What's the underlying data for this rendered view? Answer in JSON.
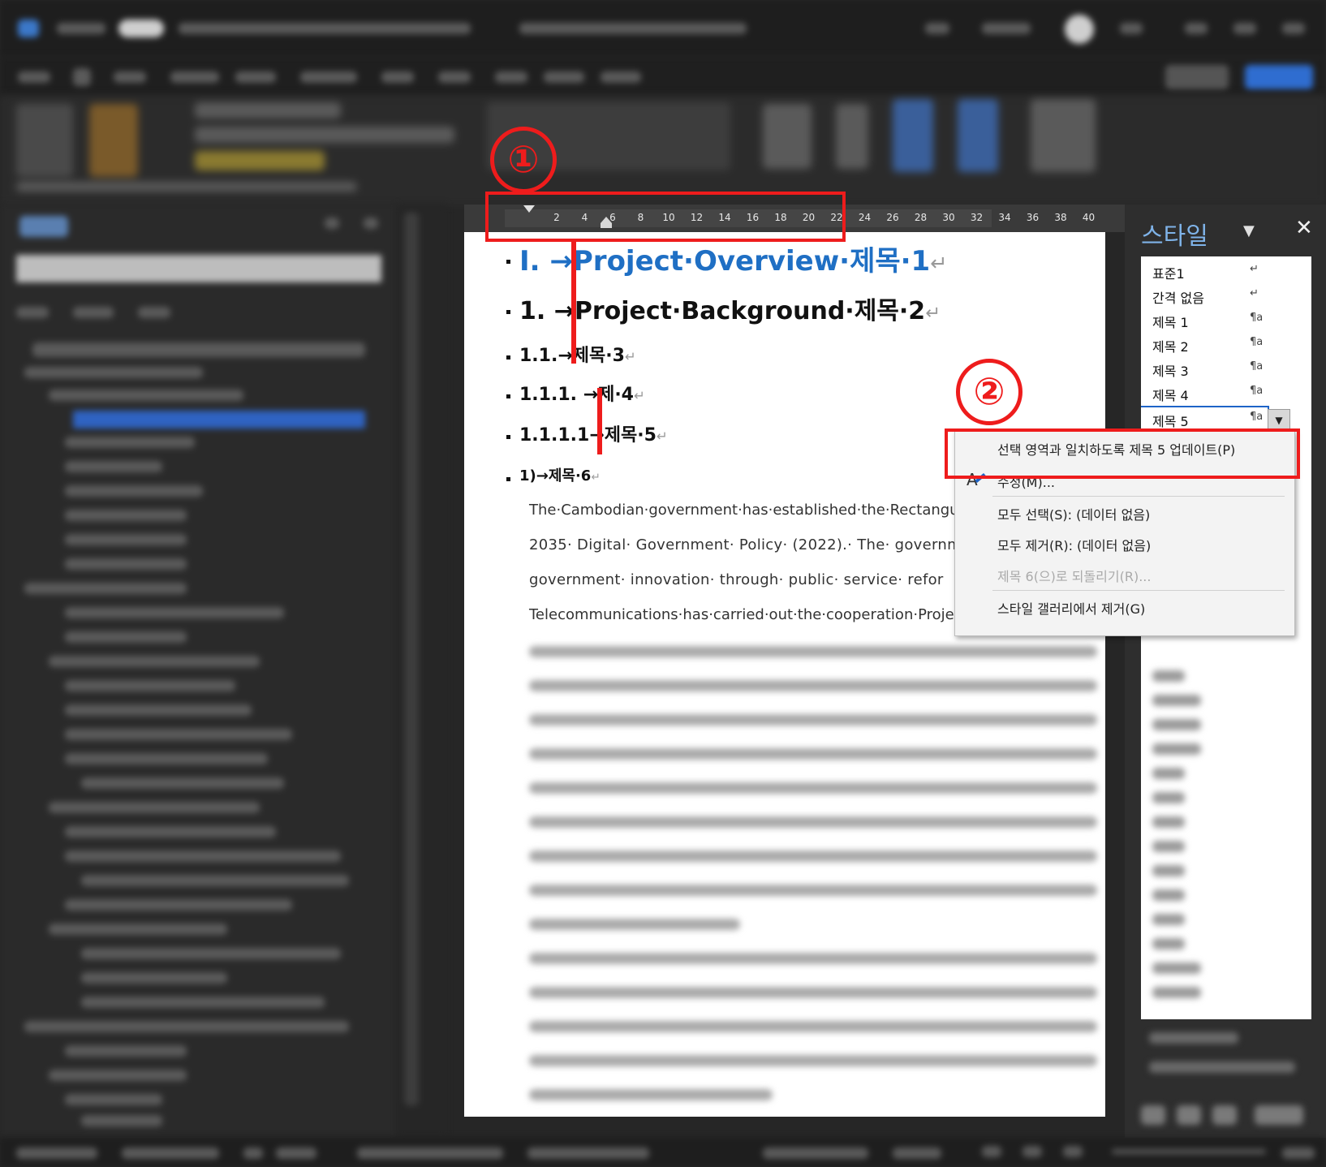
{
  "ruler": {
    "ticks": [
      "2",
      "4",
      "6",
      "8",
      "10",
      "12",
      "14",
      "16",
      "18",
      "20",
      "22",
      "24",
      "26",
      "28",
      "30",
      "32",
      "34",
      "36",
      "38",
      "40"
    ]
  },
  "document": {
    "headings": [
      {
        "text": "I. →Project·Overview·제목·1",
        "mark": "↵"
      },
      {
        "text": "1. →Project·Background·제목·2",
        "mark": "↵"
      },
      {
        "text": "1.1.→제목·3",
        "mark": "↵"
      },
      {
        "text": "1.1.1. →제·4",
        "mark": "↵"
      },
      {
        "text": "1.1.1.1→제목·5",
        "mark": "↵"
      },
      {
        "text": "1)→제목·6",
        "mark": "↵"
      }
    ],
    "body_lines": [
      "The·Cambodian·government·has·established·the·Rectangu",
      "2035· Digital· Government· Policy· (2022).· The· governme",
      "government· innovation· through· public· service· refor",
      "Telecommunications·has·carried·out·the·cooperation·Proje"
    ]
  },
  "styles_pane": {
    "title": "스타일",
    "close_symbol": "✕",
    "dropdown_symbol": "▼",
    "items": [
      {
        "name": "표준1",
        "symbol": "↵"
      },
      {
        "name": "간격 없음",
        "symbol": "↵"
      },
      {
        "name": "제목 1",
        "symbol": "¶a"
      },
      {
        "name": "제목 2",
        "symbol": "¶a"
      },
      {
        "name": "제목 3",
        "symbol": "¶a"
      },
      {
        "name": "제목 4",
        "symbol": "¶a"
      },
      {
        "name": "제목 5",
        "symbol": "¶a"
      }
    ],
    "item_dropdown_symbol": "▼"
  },
  "context_menu": {
    "items": [
      {
        "label": "선택 영역과 일치하도록 제목 5 업데이트(P)",
        "disabled": false
      },
      {
        "label": "수정(M)...",
        "disabled": false
      },
      {
        "label": "모두 선택(S): (데이터 없음)",
        "disabled": false
      },
      {
        "label": "모두 제거(R): (데이터 없음)",
        "disabled": false
      },
      {
        "label": "제목 6(으)로 되돌리기(R)...",
        "disabled": true
      },
      {
        "label": "스타일 갤러리에서 제거(G)",
        "disabled": false
      }
    ]
  },
  "annotations": {
    "first": "①",
    "second": "②"
  },
  "colors": {
    "accent_red": "#ee1c1c",
    "heading1_blue": "#1f6fc4",
    "pane_title_blue": "#7fb3e8"
  }
}
